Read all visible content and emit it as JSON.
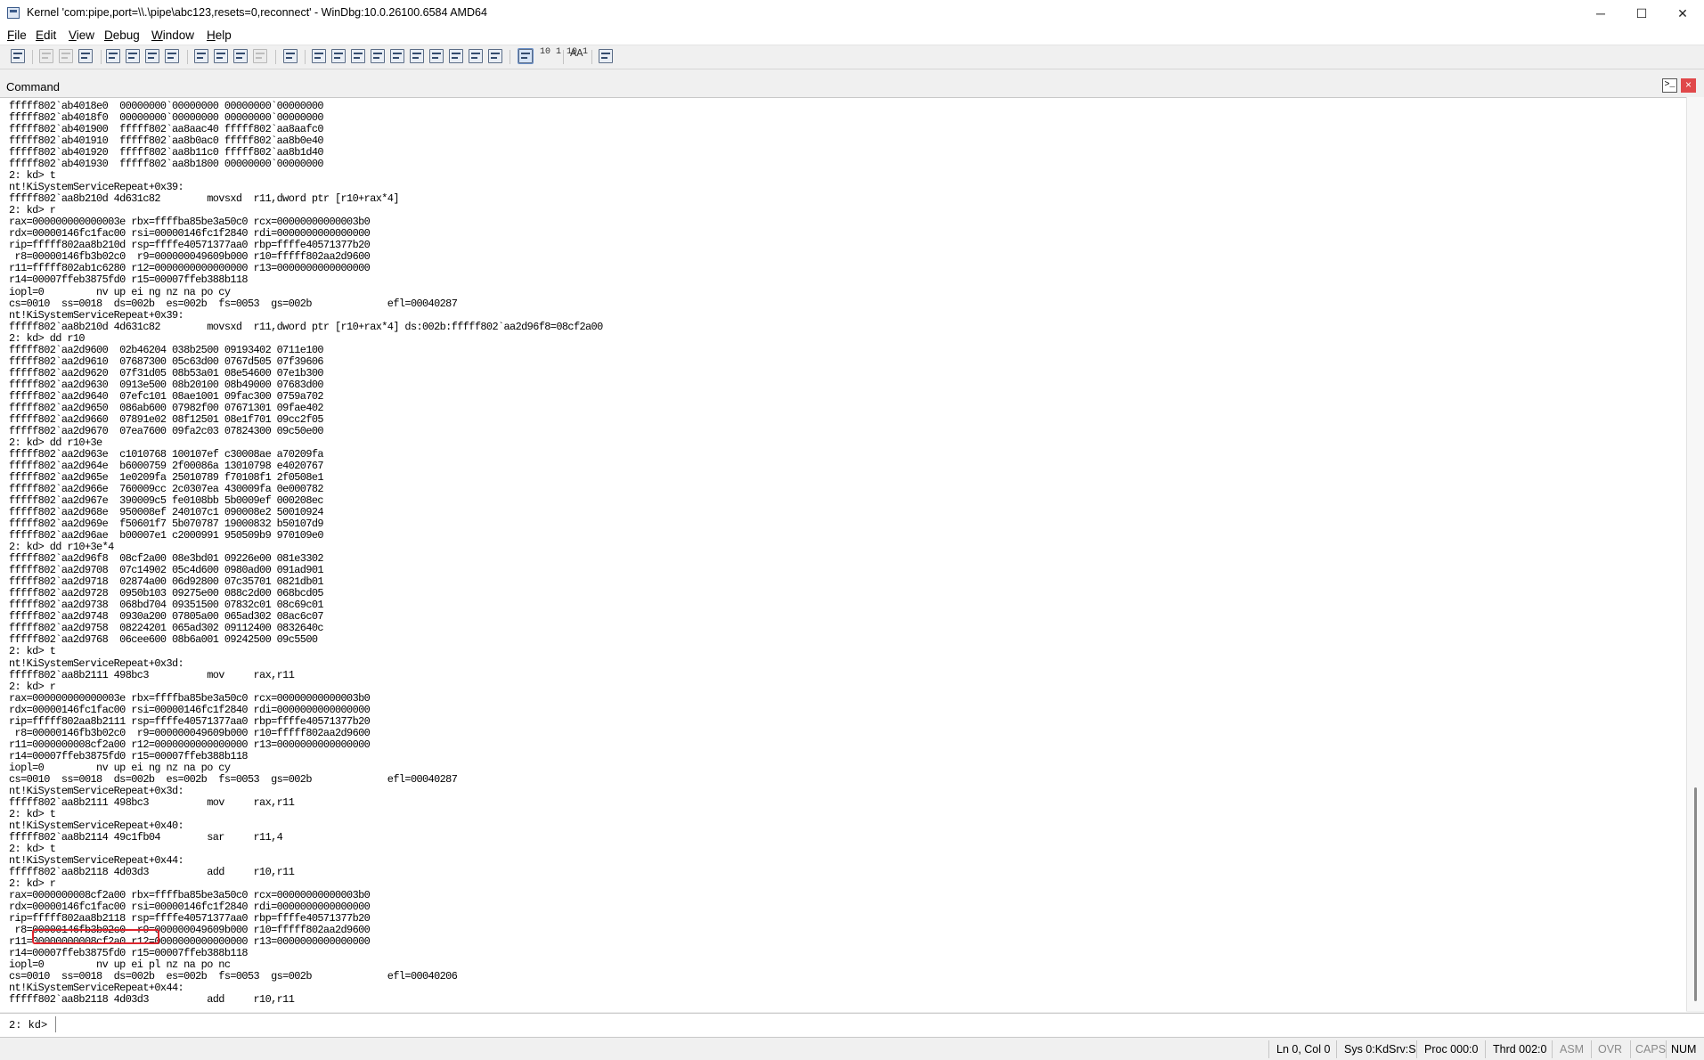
{
  "window": {
    "title": "Kernel 'com:pipe,port=\\\\.\\pipe\\abc123,resets=0,reconnect' - WinDbg:10.0.26100.6584 AMD64",
    "minimize_glyph": "─",
    "maximize_glyph": "☐",
    "close_glyph": "✕"
  },
  "menu": {
    "file": {
      "underline": "F",
      "rest": "ile"
    },
    "edit": {
      "underline": "E",
      "rest": "dit"
    },
    "view": {
      "underline": "V",
      "rest": "iew"
    },
    "debug": {
      "underline": "D",
      "rest": "ebug"
    },
    "window": {
      "underline": "W",
      "rest": "indow"
    },
    "help": {
      "underline": "H",
      "rest": "elp"
    }
  },
  "toolbar": {
    "hex_icon_text": "10 1\n10 1",
    "font_icon_text": "AA"
  },
  "command_window": {
    "title": "Command",
    "icon_glyph": ">_",
    "close_glyph": "×",
    "output": "fffff802`ab4018e0  00000000`00000000 00000000`00000000\nfffff802`ab4018f0  00000000`00000000 00000000`00000000\nfffff802`ab401900  fffff802`aa8aac40 fffff802`aa8aafc0\nfffff802`ab401910  fffff802`aa8b0ac0 fffff802`aa8b0e40\nfffff802`ab401920  fffff802`aa8b11c0 fffff802`aa8b1d40\nfffff802`ab401930  fffff802`aa8b1800 00000000`00000000\n2: kd> t\nnt!KiSystemServiceRepeat+0x39:\nfffff802`aa8b210d 4d631c82        movsxd  r11,dword ptr [r10+rax*4]\n2: kd> r\nrax=000000000000003e rbx=ffffba85be3a50c0 rcx=00000000000003b0\nrdx=00000146fc1fac00 rsi=00000146fc1f2840 rdi=0000000000000000\nrip=fffff802aa8b210d rsp=ffffe40571377aa0 rbp=ffffe40571377b20\n r8=00000146fb3b02c0  r9=000000049609b000 r10=fffff802aa2d9600\nr11=fffff802ab1c6280 r12=0000000000000000 r13=0000000000000000\nr14=00007ffeb3875fd0 r15=00007ffeb388b118\niopl=0         nv up ei ng nz na po cy\ncs=0010  ss=0018  ds=002b  es=002b  fs=0053  gs=002b             efl=00040287\nnt!KiSystemServiceRepeat+0x39:\nfffff802`aa8b210d 4d631c82        movsxd  r11,dword ptr [r10+rax*4] ds:002b:fffff802`aa2d96f8=08cf2a00\n2: kd> dd r10\nfffff802`aa2d9600  02b46204 038b2500 09193402 0711e100\nfffff802`aa2d9610  07687300 05c63d00 0767d505 07f39606\nfffff802`aa2d9620  07f31d05 08b53a01 08e54600 07e1b300\nfffff802`aa2d9630  0913e500 08b20100 08b49000 07683d00\nfffff802`aa2d9640  07efc101 08ae1001 09fac300 0759a702\nfffff802`aa2d9650  086ab600 07982f00 07671301 09fae402\nfffff802`aa2d9660  07891e02 08f12501 08e1f701 09cc2f05\nfffff802`aa2d9670  07ea7600 09fa2c03 07824300 09c50e00\n2: kd> dd r10+3e\nfffff802`aa2d963e  c1010768 100107ef c30008ae a70209fa\nfffff802`aa2d964e  b6000759 2f00086a 13010798 e4020767\nfffff802`aa2d965e  1e0209fa 25010789 f70108f1 2f0508e1\nfffff802`aa2d966e  760009cc 2c0307ea 430009fa 0e000782\nfffff802`aa2d967e  390009c5 fe0108bb 5b0009ef 000208ec\nfffff802`aa2d968e  950008ef 240107c1 090008e2 50010924\nfffff802`aa2d969e  f50601f7 5b070787 19000832 b50107d9\nfffff802`aa2d96ae  b00007e1 c2000991 950509b9 970109e0\n2: kd> dd r10+3e*4\nfffff802`aa2d96f8  08cf2a00 08e3bd01 09226e00 081e3302\nfffff802`aa2d9708  07c14902 05c4d600 0980ad00 091ad901\nfffff802`aa2d9718  02874a00 06d92800 07c35701 0821db01\nfffff802`aa2d9728  0950b103 09275e00 088c2d00 068bcd05\nfffff802`aa2d9738  068bd704 09351500 07832c01 08c69c01\nfffff802`aa2d9748  0930a200 07805a00 065ad302 08ac6c07\nfffff802`aa2d9758  08224201 065ad302 09112400 0832640c\nfffff802`aa2d9768  06cee600 08b6a001 09242500 09c5500\n2: kd> t\nnt!KiSystemServiceRepeat+0x3d:\nfffff802`aa8b2111 498bc3          mov     rax,r11\n2: kd> r\nrax=000000000000003e rbx=ffffba85be3a50c0 rcx=00000000000003b0\nrdx=00000146fc1fac00 rsi=00000146fc1f2840 rdi=0000000000000000\nrip=fffff802aa8b2111 rsp=ffffe40571377aa0 rbp=ffffe40571377b20\n r8=00000146fb3b02c0  r9=000000049609b000 r10=fffff802aa2d9600\nr11=0000000008cf2a00 r12=0000000000000000 r13=0000000000000000\nr14=00007ffeb3875fd0 r15=00007ffeb388b118\niopl=0         nv up ei ng nz na po cy\ncs=0010  ss=0018  ds=002b  es=002b  fs=0053  gs=002b             efl=00040287\nnt!KiSystemServiceRepeat+0x3d:\nfffff802`aa8b2111 498bc3          mov     rax,r11\n2: kd> t\nnt!KiSystemServiceRepeat+0x40:\nfffff802`aa8b2114 49c1fb04        sar     r11,4\n2: kd> t\nnt!KiSystemServiceRepeat+0x44:\nfffff802`aa8b2118 4d03d3          add     r10,r11\n2: kd> r\nrax=0000000008cf2a00 rbx=ffffba85be3a50c0 rcx=00000000000003b0\nrdx=00000146fc1fac00 rsi=00000146fc1f2840 rdi=0000000000000000\nrip=fffff802aa8b2118 rsp=ffffe40571377aa0 rbp=ffffe40571377b20\n r8=00000146fb3b02c0  r9=000000049609b000 r10=fffff802aa2d9600\nr11=00000000008cf2a0 r12=0000000000000000 r13=0000000000000000\nr14=00007ffeb3875fd0 r15=00007ffeb388b118\niopl=0         nv up ei pl nz na po nc\ncs=0010  ss=0018  ds=002b  es=002b  fs=0053  gs=002b             efl=00040206\nnt!KiSystemServiceRepeat+0x44:\nfffff802`aa8b2118 4d03d3          add     r10,r11",
    "prompt": "2: kd>",
    "input_value": ""
  },
  "status_bar": {
    "position": "Ln 0, Col 0",
    "sys": "Sys 0:KdSrv:S",
    "proc": "Proc 000:0",
    "thrd": "Thrd 002:0",
    "asm": "ASM",
    "ovr": "OVR",
    "caps": "CAPS",
    "num": "NUM"
  },
  "colors": {
    "highlight": "#e0262f",
    "close_button": "#e0484a"
  }
}
